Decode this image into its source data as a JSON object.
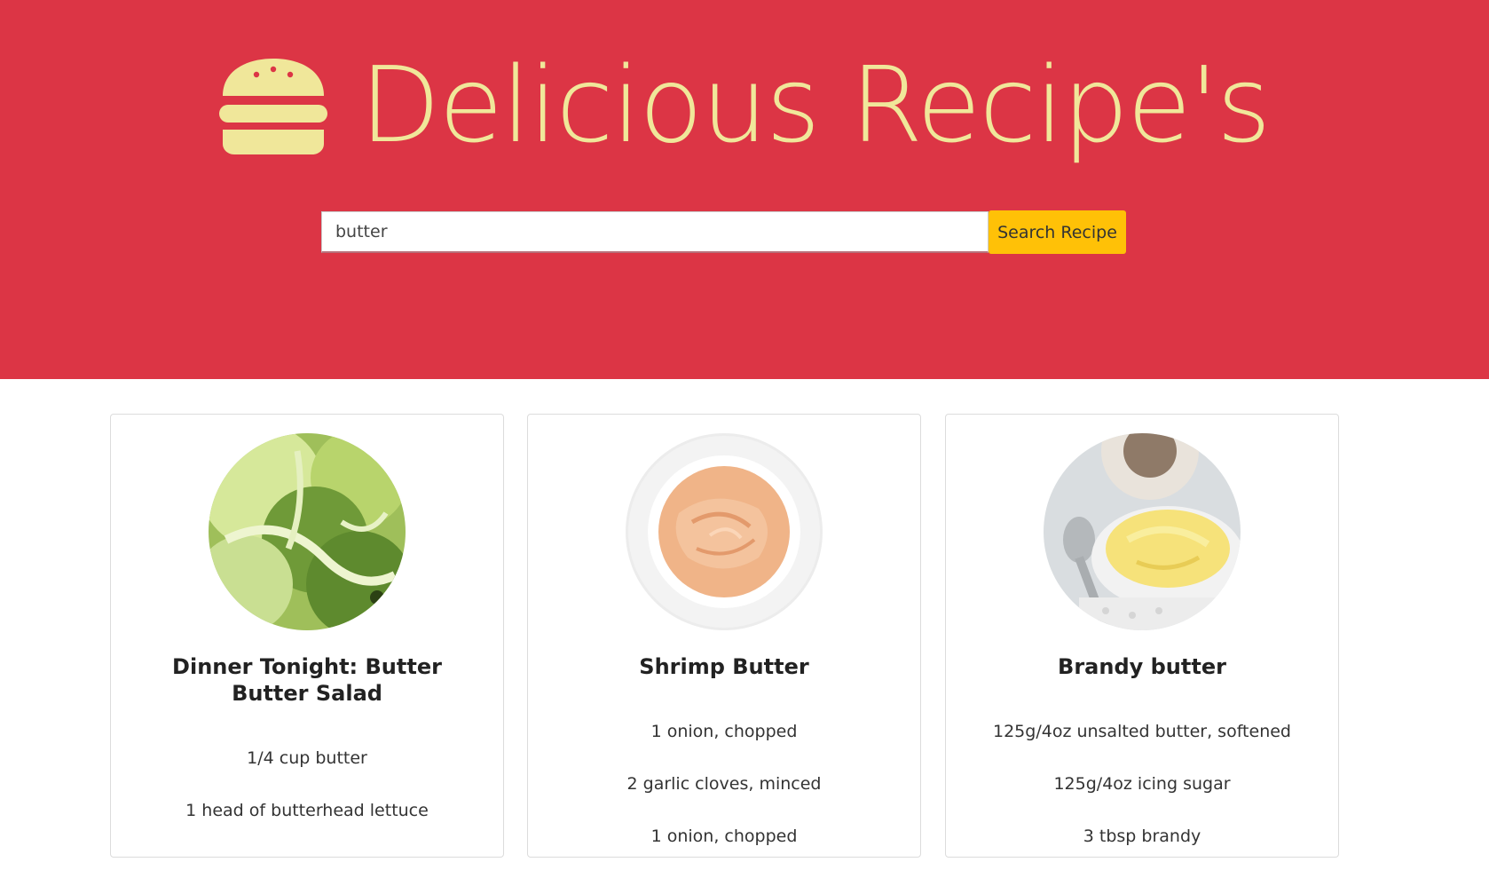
{
  "colors": {
    "brand": "#dc3545",
    "accent": "#f0e79a",
    "button": "#ffc107"
  },
  "header": {
    "logo_icon": "hamburger-icon",
    "title": "Delicious Recipe's"
  },
  "search": {
    "value": "butter",
    "button_label": "Search Recipe"
  },
  "recipes": [
    {
      "title": "Dinner Tonight: Butter Butter Salad",
      "image": "butter-lettuce-photo",
      "ingredients": [
        "1/4 cup butter",
        "1 head of butterhead lettuce"
      ]
    },
    {
      "title": "Shrimp Butter",
      "image": "shrimp-butter-bowl-photo",
      "ingredients": [
        "1 onion, chopped",
        "2 garlic cloves, minced",
        "1 onion, chopped"
      ]
    },
    {
      "title": "Brandy butter",
      "image": "brandy-butter-bowl-photo",
      "ingredients": [
        "125g/4oz unsalted butter, softened",
        "125g/4oz icing sugar",
        "3 tbsp brandy"
      ]
    }
  ]
}
